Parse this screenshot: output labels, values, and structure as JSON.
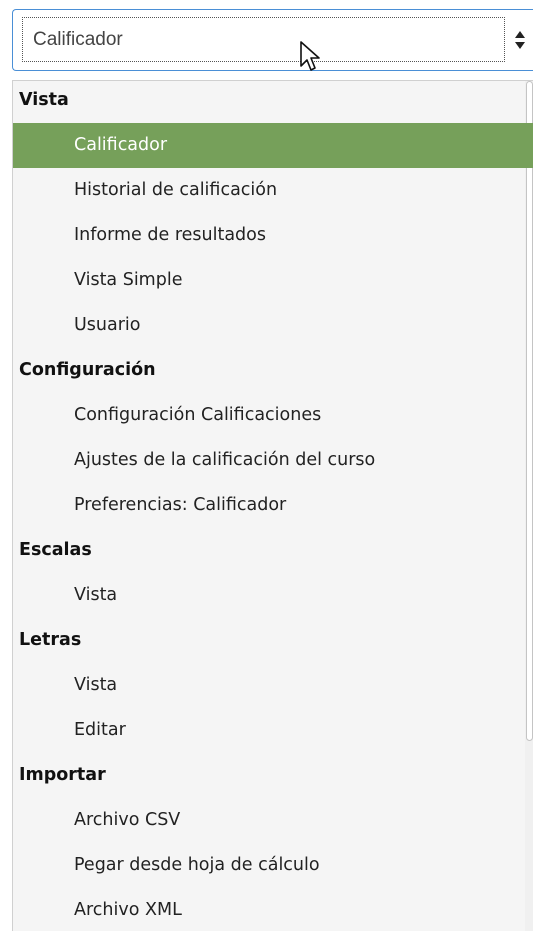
{
  "select": {
    "value": "Calificador",
    "icon": "up-down-arrows-icon"
  },
  "menu": {
    "groups": [
      {
        "label": "Vista",
        "options": [
          "Calificador",
          "Historial de calificación",
          "Informe de resultados",
          "Vista Simple",
          "Usuario"
        ]
      },
      {
        "label": "Configuración",
        "options": [
          "Configuración Calificaciones",
          "Ajustes de la calificación del curso",
          "Preferencias: Calificador"
        ]
      },
      {
        "label": "Escalas",
        "options": [
          "Vista"
        ]
      },
      {
        "label": "Letras",
        "options": [
          "Vista",
          "Editar"
        ]
      },
      {
        "label": "Importar",
        "options": [
          "Archivo CSV",
          "Pegar desde hoja de cálculo",
          "Archivo XML"
        ]
      }
    ],
    "selected_option": "Calificador",
    "selected_color": "#76a05a"
  }
}
